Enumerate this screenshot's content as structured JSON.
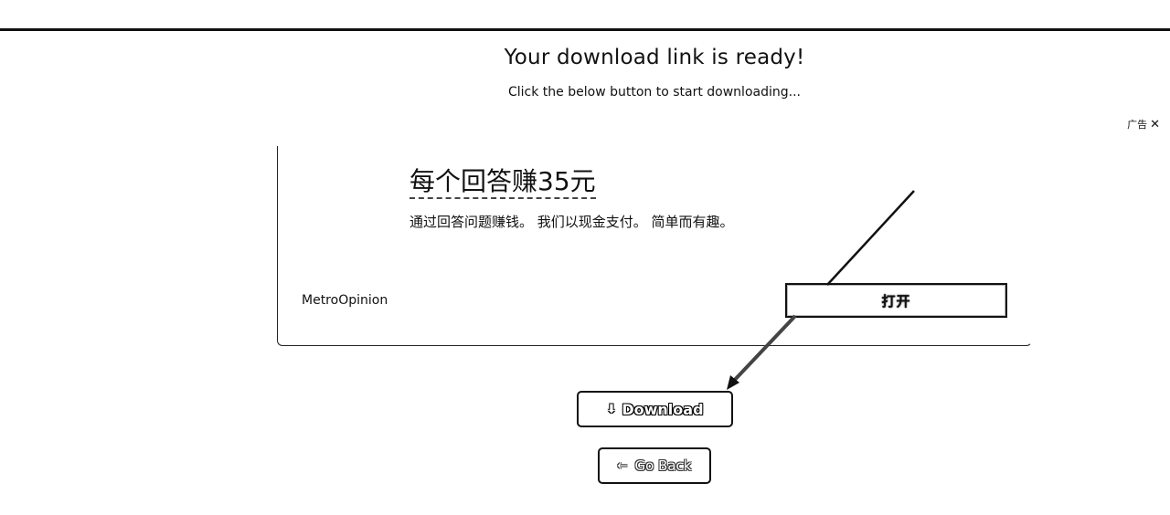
{
  "header": {
    "title": "Your download link is ready!",
    "subtitle": "Click the below button to start downloading..."
  },
  "ad": {
    "label": "广告",
    "close_icon": "close-icon",
    "headline": "每个回答赚35元",
    "description": "通过回答问题赚钱。 我们以现金支付。 简单而有趣。",
    "advertiser": "MetroOpinion",
    "open_button_label": "打开"
  },
  "actions": {
    "download_label": "Download",
    "download_icon": "download-icon",
    "goback_label": "Go Back",
    "goback_icon": "arrow-left-icon"
  }
}
